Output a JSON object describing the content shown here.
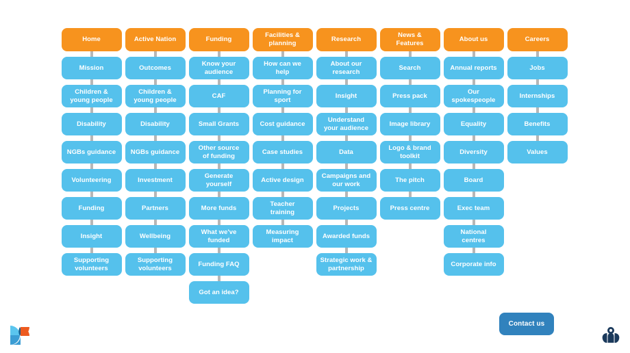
{
  "page": {
    "title": "Sport England site map",
    "background_color": "#ffffff",
    "root_color": "#f7931e",
    "child_color": "#55c1ec",
    "connector_color": "#b7b7b7",
    "contact_button_color": "#3182bd"
  },
  "columns": [
    {
      "root": "Home",
      "children": [
        "Mission",
        "Children &\nyoung people",
        "Disability",
        "NGBs guidance",
        "Volunteering",
        "Funding",
        "Insight",
        "Supporting\nvolunteers"
      ]
    },
    {
      "root": "Active Nation",
      "children": [
        "Outcomes",
        "Children &\nyoung people",
        "Disability",
        "NGBs guidance",
        "Investment",
        "Partners",
        "Wellbeing",
        "Supporting\nvolunteers"
      ]
    },
    {
      "root": "Funding",
      "children": [
        "Know your\naudience",
        "CAF",
        "Small Grants",
        "Other source\nof funding",
        "Generate\nyourself",
        "More funds",
        "What we've\nfunded",
        "Funding FAQ",
        "Got an idea?"
      ]
    },
    {
      "root": "Facilities &\nplanning",
      "children": [
        "How can we\nhelp",
        "Planning for\nsport",
        "Cost guidance",
        "Case studies",
        "Active design",
        "Teacher\ntraining",
        "Measuring\nimpact"
      ]
    },
    {
      "root": "Research",
      "children": [
        "About our\nresearch",
        "Insight",
        "Understand\nyour audience",
        "Data",
        "Campaigns and\nour work",
        "Projects",
        "Awarded funds",
        "Strategic work &\npartnership"
      ]
    },
    {
      "root": "News &\nFeatures",
      "children": [
        "Search",
        "Press pack",
        "Image library",
        "Logo & brand\ntoolkit",
        "The pitch",
        "Press centre"
      ]
    },
    {
      "root": "About us",
      "children": [
        "Annual reports",
        "Our\nspokespeople",
        "Equality",
        "Diversity",
        "Board",
        "Exec team",
        "National\ncentres",
        "Corporate info"
      ]
    },
    {
      "root": "Careers",
      "children": [
        "Jobs",
        "Internships",
        "Benefits",
        "Values"
      ]
    }
  ],
  "contact": {
    "label": "Contact us"
  },
  "logos": {
    "left": {
      "name": "petal-logo",
      "colors": [
        "#5bc5ee",
        "#3b9dd4",
        "#1b5f8c",
        "#ed5a1f",
        "#7cc9e8"
      ]
    },
    "right": {
      "name": "sport-england-logo",
      "color": "#1b3a5c"
    }
  }
}
